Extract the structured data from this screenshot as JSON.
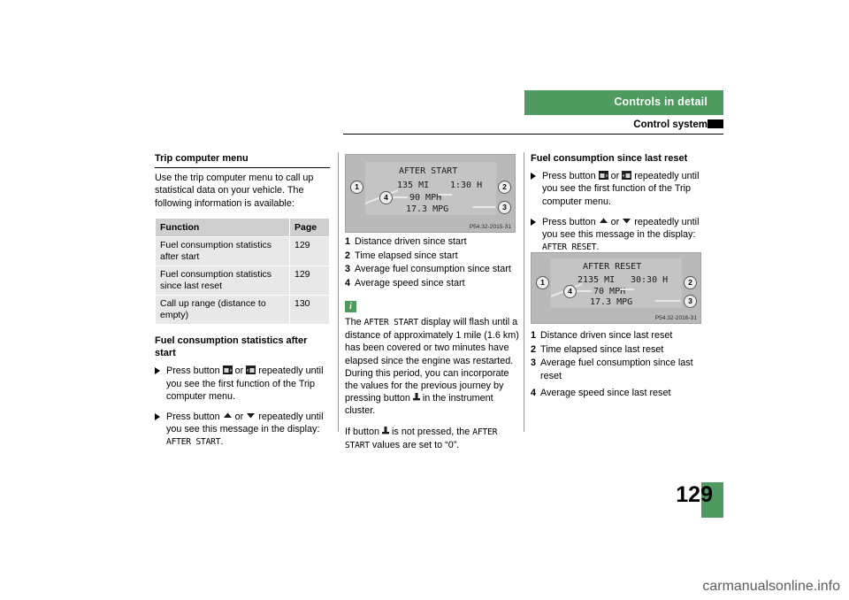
{
  "header": {
    "title": "Controls in detail",
    "subtitle": "Control system"
  },
  "page_number": "129",
  "col1": {
    "section_title": "Trip computer menu",
    "intro": "Use the trip computer menu to call up statistical data on your vehicle. The following information is available:",
    "table": {
      "headers": [
        "Function",
        "Page"
      ],
      "rows": [
        [
          "Fuel consumption statistics after start",
          "129"
        ],
        [
          "Fuel consumption statistics since last reset",
          "129"
        ],
        [
          "Call up range (distance to empty)",
          "130"
        ]
      ]
    },
    "section2_title": "Fuel consumption statistics after start",
    "bullets": [
      {
        "text_before": "Press button",
        "icon1": "display-left-button-icon",
        "or": "or",
        "icon2": "display-right-button-icon",
        "text_after": "repeatedly until you see the first function of the Trip computer menu."
      },
      {
        "text_before": "Press button",
        "icon1": "arrow-up-button-icon",
        "or": "or",
        "icon2": "arrow-down-button-icon",
        "text_after": "repeatedly until you see this message in the display:",
        "display_value": "AFTER START",
        "trailing": "."
      }
    ]
  },
  "col2": {
    "illustration": {
      "title": "AFTER START",
      "line1_left": "135 MI",
      "line1_right": "1:30 H",
      "line2": "90 MPH",
      "line3": "17.3 MPG",
      "code": "P54.32-2015-31",
      "callouts": [
        "1",
        "2",
        "3",
        "4"
      ]
    },
    "legend": [
      {
        "n": "1",
        "text": "Distance driven since start"
      },
      {
        "n": "2",
        "text": "Time elapsed since start"
      },
      {
        "n": "3",
        "text": "Average fuel consumption since start"
      },
      {
        "n": "4",
        "text": "Average speed since start"
      }
    ],
    "note": {
      "icon": "info-icon",
      "p1_a": "The ",
      "p1_disp": "AFTER START",
      "p1_b": " display will flash until a distance of approximately 1 mile (1.6 km) has been covered or two minutes have elapsed since the engine was restarted. During this period, you can incorporate the values for the previous journey by pressing button",
      "p1_icon": "reset-button-icon",
      "p1_c": "in the instrument cluster.",
      "p2_a": "If button",
      "p2_icon": "reset-button-icon",
      "p2_b": "is not pressed, the ",
      "p2_disp": "AFTER START",
      "p2_c": " values are set to “0”."
    }
  },
  "col3": {
    "section_title": "Fuel consumption since last reset",
    "bullets": [
      {
        "text_before": "Press button",
        "icon1": "display-left-button-icon",
        "or": "or",
        "icon2": "display-right-button-icon",
        "text_after": "repeatedly until you see the first function of the Trip computer menu."
      },
      {
        "text_before": "Press button",
        "icon1": "arrow-up-button-icon",
        "or": "or",
        "icon2": "arrow-down-button-icon",
        "text_after": "repeatedly until you see this message in the display:",
        "display_value": "AFTER RESET",
        "trailing": "."
      }
    ],
    "illustration": {
      "title": "AFTER RESET",
      "line1_left": "2135 MI",
      "line1_right": "30:30 H",
      "line2": "70 MPH",
      "line3": "17.3 MPG",
      "code": "P54.32-2016-31",
      "callouts": [
        "1",
        "2",
        "3",
        "4"
      ]
    },
    "legend": [
      {
        "n": "1",
        "text": "Distance driven since last reset"
      },
      {
        "n": "2",
        "text": "Time elapsed since last reset"
      },
      {
        "n": "3",
        "text": "Average fuel consumption since last reset"
      },
      {
        "n": "4",
        "text": "Average speed since last reset"
      }
    ]
  },
  "watermark": "carmanualsonline.info"
}
